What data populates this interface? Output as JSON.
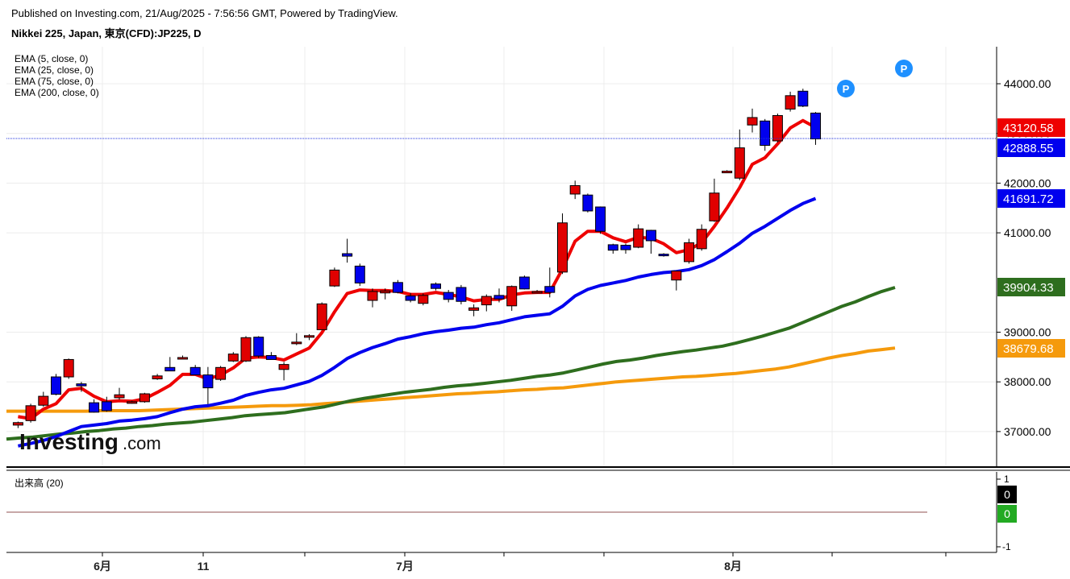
{
  "header": {
    "published": "Published on Investing.com, 21/Aug/2025 - 7:56:56 GMT, Powered by TradingView.",
    "symbol": "Nikkei 225, Japan, 東京(CFD):JP225, D"
  },
  "legend": [
    "EMA (5, close, 0)",
    "EMA (25, close, 0)",
    "EMA (75, close, 0)",
    "EMA (200, close, 0)"
  ],
  "watermark": {
    "brand": "Investing",
    "suffix": ".com"
  },
  "markers": [
    "P",
    "P"
  ],
  "price_labels": [
    {
      "value": "43120.58",
      "color": "#ee0000"
    },
    {
      "value": "42888.55",
      "color": "#0000ee"
    },
    {
      "value": "41691.72",
      "color": "#0000ee"
    },
    {
      "value": "39904.33",
      "color": "#2e6e1e"
    },
    {
      "value": "38679.68",
      "color": "#f59a0c"
    }
  ],
  "volume": {
    "label": "出来高 (20)",
    "ticks": [
      "1",
      "-1"
    ],
    "badges": [
      {
        "value": "0",
        "color": "#000000"
      },
      {
        "value": "0",
        "color": "#22aa22"
      }
    ]
  },
  "chart_data": {
    "type": "candlestick",
    "title": "Nikkei 225, Japan, 東京(CFD):JP225, D",
    "yticks": [
      "44000.00",
      "43000.00",
      "42000.00",
      "41000.00",
      "39000.00",
      "38000.00",
      "37000.00"
    ],
    "ylim": [
      36400,
      44800
    ],
    "xticks": [
      "6月",
      "11",
      "7月",
      "8月"
    ],
    "grid": true,
    "colors": {
      "up": "#e00000",
      "down": "#0000ee"
    },
    "candles": [
      {
        "o": 37130,
        "h": 37200,
        "l": 37070,
        "c": 37180
      },
      {
        "o": 37220,
        "h": 37560,
        "l": 37180,
        "c": 37520
      },
      {
        "o": 37530,
        "h": 37800,
        "l": 37500,
        "c": 37710
      },
      {
        "o": 38100,
        "h": 38160,
        "l": 37730,
        "c": 37750
      },
      {
        "o": 38100,
        "h": 38470,
        "l": 38060,
        "c": 38450
      },
      {
        "o": 37960,
        "h": 38000,
        "l": 37800,
        "c": 37920
      },
      {
        "o": 37580,
        "h": 37650,
        "l": 37380,
        "c": 37390
      },
      {
        "o": 37600,
        "h": 37700,
        "l": 37400,
        "c": 37420
      },
      {
        "o": 37680,
        "h": 37880,
        "l": 37640,
        "c": 37740
      },
      {
        "o": 37580,
        "h": 37620,
        "l": 37560,
        "c": 37600
      },
      {
        "o": 37600,
        "h": 37780,
        "l": 37580,
        "c": 37760
      },
      {
        "o": 38060,
        "h": 38160,
        "l": 38040,
        "c": 38120
      },
      {
        "o": 38290,
        "h": 38500,
        "l": 38240,
        "c": 38220
      },
      {
        "o": 38480,
        "h": 38530,
        "l": 38460,
        "c": 38490
      },
      {
        "o": 38290,
        "h": 38340,
        "l": 38220,
        "c": 38140
      },
      {
        "o": 38140,
        "h": 38300,
        "l": 37550,
        "c": 37880
      },
      {
        "o": 38050,
        "h": 38320,
        "l": 38020,
        "c": 38290
      },
      {
        "o": 38420,
        "h": 38600,
        "l": 38400,
        "c": 38560
      },
      {
        "o": 38420,
        "h": 38920,
        "l": 38400,
        "c": 38890
      },
      {
        "o": 38900,
        "h": 38920,
        "l": 38480,
        "c": 38520
      },
      {
        "o": 38530,
        "h": 38600,
        "l": 38480,
        "c": 38450
      },
      {
        "o": 38250,
        "h": 38400,
        "l": 38030,
        "c": 38350
      },
      {
        "o": 38780,
        "h": 38980,
        "l": 38740,
        "c": 38800
      },
      {
        "o": 38900,
        "h": 38960,
        "l": 38840,
        "c": 38930
      },
      {
        "o": 39050,
        "h": 39600,
        "l": 39050,
        "c": 39570
      },
      {
        "o": 39930,
        "h": 40300,
        "l": 39910,
        "c": 40250
      },
      {
        "o": 40580,
        "h": 40880,
        "l": 40400,
        "c": 40530
      },
      {
        "o": 40330,
        "h": 40380,
        "l": 39930,
        "c": 39990
      },
      {
        "o": 39640,
        "h": 39880,
        "l": 39500,
        "c": 39820
      },
      {
        "o": 39790,
        "h": 39880,
        "l": 39660,
        "c": 39830
      },
      {
        "o": 40000,
        "h": 40050,
        "l": 39780,
        "c": 39800
      },
      {
        "o": 39730,
        "h": 39790,
        "l": 39600,
        "c": 39640
      },
      {
        "o": 39580,
        "h": 39780,
        "l": 39540,
        "c": 39740
      },
      {
        "o": 39970,
        "h": 40000,
        "l": 39840,
        "c": 39880
      },
      {
        "o": 39800,
        "h": 39850,
        "l": 39600,
        "c": 39660
      },
      {
        "o": 39900,
        "h": 39950,
        "l": 39560,
        "c": 39620
      },
      {
        "o": 39440,
        "h": 39560,
        "l": 39320,
        "c": 39490
      },
      {
        "o": 39550,
        "h": 39760,
        "l": 39420,
        "c": 39720
      },
      {
        "o": 39740,
        "h": 39880,
        "l": 39600,
        "c": 39670
      },
      {
        "o": 39530,
        "h": 39940,
        "l": 39430,
        "c": 39920
      },
      {
        "o": 40110,
        "h": 40140,
        "l": 39860,
        "c": 39870
      },
      {
        "o": 39810,
        "h": 39850,
        "l": 39780,
        "c": 39820
      },
      {
        "o": 39920,
        "h": 40300,
        "l": 39700,
        "c": 39800
      },
      {
        "o": 40210,
        "h": 41390,
        "l": 40170,
        "c": 41200
      },
      {
        "o": 41780,
        "h": 42050,
        "l": 41680,
        "c": 41950
      },
      {
        "o": 41760,
        "h": 41790,
        "l": 41410,
        "c": 41440
      },
      {
        "o": 41520,
        "h": 41530,
        "l": 40980,
        "c": 41030
      },
      {
        "o": 40760,
        "h": 40780,
        "l": 40580,
        "c": 40650
      },
      {
        "o": 40750,
        "h": 40780,
        "l": 40580,
        "c": 40660
      },
      {
        "o": 40710,
        "h": 41170,
        "l": 40690,
        "c": 41080
      },
      {
        "o": 41050,
        "h": 41060,
        "l": 40580,
        "c": 40840
      },
      {
        "o": 40570,
        "h": 40590,
        "l": 40520,
        "c": 40550
      },
      {
        "o": 40050,
        "h": 40210,
        "l": 39840,
        "c": 40230
      },
      {
        "o": 40420,
        "h": 40880,
        "l": 40380,
        "c": 40800
      },
      {
        "o": 40680,
        "h": 41170,
        "l": 40640,
        "c": 41070
      },
      {
        "o": 41240,
        "h": 42090,
        "l": 41220,
        "c": 41800
      },
      {
        "o": 42230,
        "h": 42260,
        "l": 42210,
        "c": 42240
      },
      {
        "o": 42100,
        "h": 43080,
        "l": 42060,
        "c": 42710
      },
      {
        "o": 43170,
        "h": 43500,
        "l": 43020,
        "c": 43320
      },
      {
        "o": 43250,
        "h": 43290,
        "l": 42650,
        "c": 42760
      },
      {
        "o": 42850,
        "h": 43400,
        "l": 42820,
        "c": 43360
      },
      {
        "o": 43490,
        "h": 43840,
        "l": 43440,
        "c": 43760
      },
      {
        "o": 43850,
        "h": 43900,
        "l": 43530,
        "c": 43550
      },
      {
        "o": 43410,
        "h": 43430,
        "l": 42770,
        "c": 42890
      }
    ],
    "series": [
      {
        "name": "EMA (5, close, 0)",
        "color": "#ee0000",
        "values": [
          37300,
          37260,
          37450,
          37560,
          37840,
          37870,
          37710,
          37600,
          37620,
          37610,
          37660,
          37790,
          37930,
          38150,
          38150,
          38060,
          38140,
          38280,
          38480,
          38500,
          38490,
          38440,
          38560,
          38680,
          38990,
          39410,
          39780,
          39850,
          39840,
          39840,
          39820,
          39760,
          39760,
          39800,
          39760,
          39710,
          39630,
          39660,
          39660,
          39750,
          39790,
          39800,
          39800,
          40270,
          40830,
          41030,
          41030,
          40900,
          40820,
          40910,
          40890,
          40780,
          40600,
          40660,
          40800,
          41130,
          41500,
          41910,
          42380,
          42510,
          42790,
          43110,
          43260,
          43120
        ]
      },
      {
        "name": "EMA (25, close, 0)",
        "color": "#0000ee",
        "values": [
          36710,
          36760,
          36820,
          36900,
          37000,
          37100,
          37130,
          37160,
          37210,
          37230,
          37260,
          37300,
          37380,
          37450,
          37500,
          37520,
          37570,
          37630,
          37730,
          37790,
          37840,
          37870,
          37940,
          38010,
          38130,
          38290,
          38470,
          38590,
          38690,
          38770,
          38860,
          38910,
          38970,
          39010,
          39040,
          39080,
          39100,
          39150,
          39190,
          39250,
          39310,
          39340,
          39370,
          39520,
          39730,
          39860,
          39940,
          39990,
          40040,
          40110,
          40160,
          40200,
          40220,
          40260,
          40340,
          40460,
          40620,
          40790,
          40990,
          41130,
          41290,
          41450,
          41590,
          41690
        ]
      },
      {
        "name": "EMA (75, close, 0)",
        "color": "#2e6e1e",
        "values": [
          36850,
          36870,
          36890,
          36920,
          36950,
          36970,
          37000,
          37020,
          37050,
          37070,
          37100,
          37120,
          37150,
          37170,
          37190,
          37220,
          37250,
          37280,
          37320,
          37340,
          37360,
          37380,
          37420,
          37460,
          37500,
          37560,
          37620,
          37670,
          37710,
          37750,
          37790,
          37820,
          37850,
          37890,
          37920,
          37940,
          37970,
          38000,
          38030,
          38070,
          38110,
          38140,
          38180,
          38240,
          38300,
          38360,
          38410,
          38440,
          38480,
          38530,
          38570,
          38610,
          38640,
          38680,
          38720,
          38780,
          38850,
          38920,
          39000,
          39080,
          39190,
          39300,
          39410,
          39520,
          39610,
          39720,
          39820,
          39900
        ]
      },
      {
        "name": "EMA (200, close, 0)",
        "color": "#f59a0c",
        "values": [
          37410,
          37410,
          37410,
          37410,
          37410,
          37410,
          37410,
          37420,
          37420,
          37420,
          37420,
          37430,
          37440,
          37450,
          37460,
          37470,
          37480,
          37490,
          37500,
          37510,
          37520,
          37520,
          37530,
          37540,
          37560,
          37580,
          37600,
          37620,
          37640,
          37660,
          37680,
          37700,
          37720,
          37740,
          37760,
          37770,
          37790,
          37800,
          37820,
          37840,
          37850,
          37870,
          37880,
          37910,
          37940,
          37970,
          38000,
          38020,
          38040,
          38060,
          38080,
          38100,
          38110,
          38130,
          38150,
          38170,
          38200,
          38230,
          38260,
          38300,
          38360,
          38420,
          38480,
          38530,
          38570,
          38620,
          38650,
          38680
        ]
      }
    ]
  }
}
